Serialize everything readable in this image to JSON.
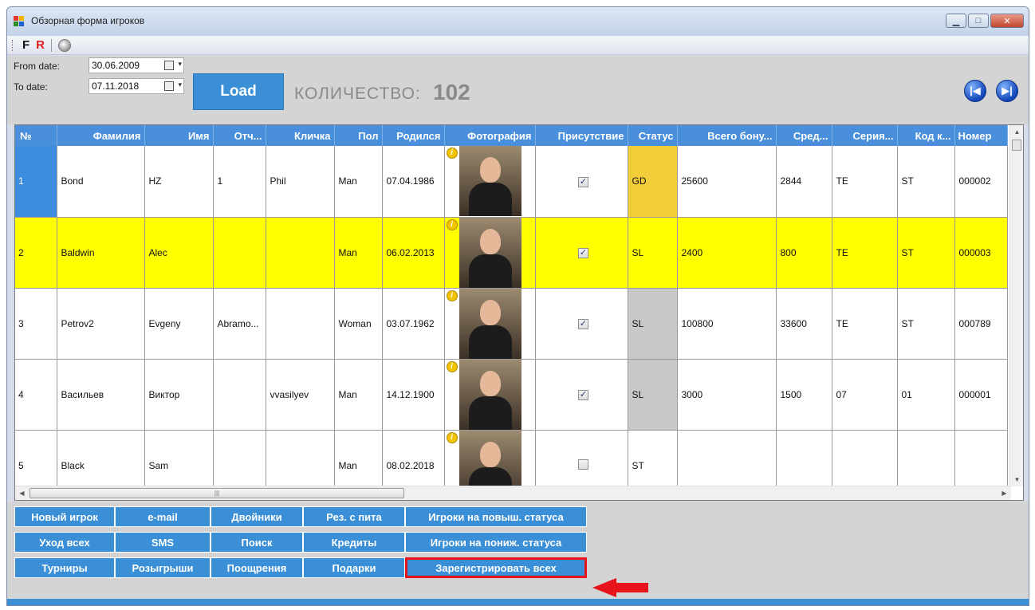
{
  "window": {
    "title": "Обзорная форма игроков"
  },
  "toolbar": {
    "f_label": "F",
    "r_label": "R"
  },
  "filter": {
    "from_label": "From date:",
    "from_value": "30.06.2009",
    "to_label": "To date:",
    "to_value": "07.11.2018",
    "load_label": "Load",
    "count_label": "КОЛИЧЕСТВО:",
    "count_value": "102"
  },
  "grid": {
    "columns": [
      "№",
      "Фамилия",
      "Имя",
      "Отч...",
      "Кличка",
      "Пол",
      "Родился",
      "Фотография",
      "Присутствие",
      "Статус",
      "Всего бону...",
      "Сред...",
      "Серия...",
      "Код к...",
      "Номер"
    ],
    "rows": [
      {
        "num": "1",
        "surname": "Bond",
        "name": "HZ",
        "patronymic": "1",
        "nick": "Phil",
        "sex": "Man",
        "born": "07.04.1986",
        "present": true,
        "status": "GD",
        "bonus": "25600",
        "avg": "2844",
        "series": "TE",
        "code": "ST",
        "number": "000002"
      },
      {
        "num": "2",
        "surname": "Baldwin",
        "name": "Alec",
        "patronymic": "",
        "nick": "",
        "sex": "Man",
        "born": "06.02.2013",
        "present": true,
        "status": "SL",
        "bonus": "2400",
        "avg": "800",
        "series": "TE",
        "code": "ST",
        "number": "000003"
      },
      {
        "num": "3",
        "surname": "Petrov2",
        "name": "Evgeny",
        "patronymic": "Abramo...",
        "nick": "",
        "sex": "Woman",
        "born": "03.07.1962",
        "present": true,
        "status": "SL",
        "bonus": "100800",
        "avg": "33600",
        "series": "TE",
        "code": "ST",
        "number": "000789"
      },
      {
        "num": "4",
        "surname": "Васильев",
        "name": "Виктор",
        "patronymic": "",
        "nick": "vvasilyev",
        "sex": "Man",
        "born": "14.12.1900",
        "present": true,
        "status": "SL",
        "bonus": "3000",
        "avg": "1500",
        "series": "07",
        "code": "01",
        "number": "000001"
      },
      {
        "num": "5",
        "surname": "Black",
        "name": "Sam",
        "patronymic": "",
        "nick": "",
        "sex": "Man",
        "born": "08.02.2018",
        "present": false,
        "status": "ST",
        "bonus": "",
        "avg": "",
        "series": "",
        "code": "",
        "number": ""
      }
    ]
  },
  "actions": {
    "new_player": "Новый игрок",
    "email": "e-mail",
    "duplicates": "Двойники",
    "res_pit": "Рез. с пита",
    "status_up": "Игроки на повыш. статуса",
    "leave_all": "Уход всех",
    "sms": "SMS",
    "search": "Поиск",
    "credits": "Кредиты",
    "status_down": "Игроки на пониж. статуса",
    "tournaments": "Турниры",
    "draws": "Розыгрыши",
    "rewards": "Поощрения",
    "gifts": "Подарки",
    "register_all": "Зарегистрировать всех"
  },
  "colors": {
    "accent": "#3a8fd6",
    "header": "#4a8fdc",
    "highlight_row": "#ffff00",
    "status_gd": "#f1cd3a",
    "status_sl": "#c8c8c8",
    "callout": "#e8141c"
  }
}
